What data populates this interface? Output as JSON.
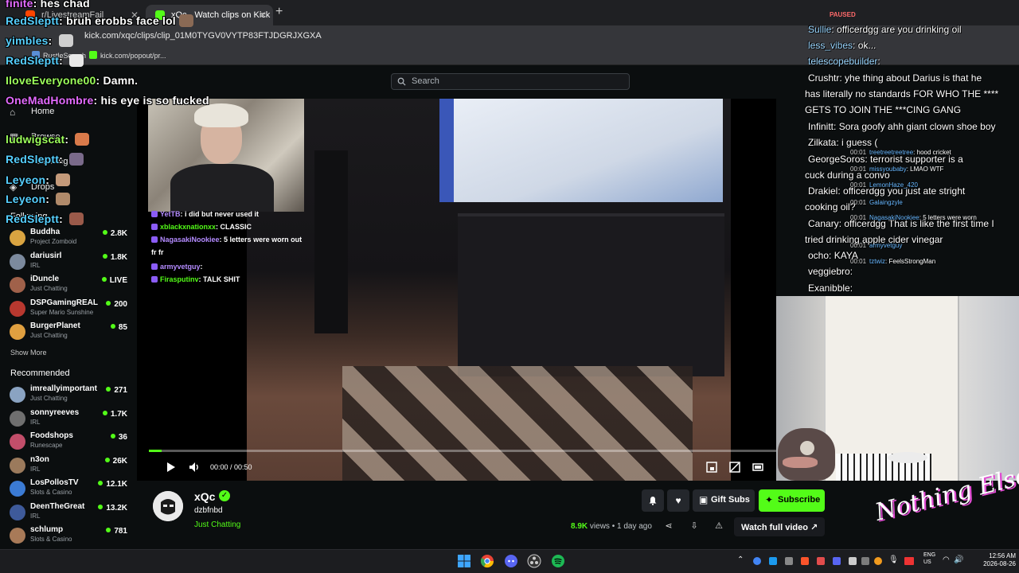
{
  "browser": {
    "tabs": [
      {
        "label": "r/LivestreamFail",
        "active": false
      },
      {
        "label": "xQc - Watch clips on Kick",
        "active": true
      }
    ],
    "url": "kick.com/xqc/clips/clip_01M0TYGV0VYTP83FTJDGRJXGXA",
    "bookmarks": [
      "RustleSearch",
      "kick.com/popout/pr..."
    ]
  },
  "header": {
    "search_placeholder": "Search"
  },
  "sidebar": {
    "nav": [
      "Home",
      "Browse",
      "Following",
      "Drops"
    ],
    "following_heading": "Following",
    "following": [
      {
        "name": "Buddha",
        "category": "Project Zomboid",
        "viewers": "2.8K",
        "color": "#d9a441"
      },
      {
        "name": "dariusirl",
        "category": "IRL",
        "viewers": "1.8K",
        "color": "#7c8a9e"
      },
      {
        "name": "iDuncle",
        "category": "Just Chatting",
        "viewers": "LIVE",
        "color": "#a0614a"
      },
      {
        "name": "DSPGamingREAL",
        "category": "Super Mario Sunshine",
        "viewers": "200",
        "color": "#b8382f"
      },
      {
        "name": "BurgerPlanet",
        "category": "Just Chatting",
        "viewers": "85",
        "color": "#e0a040"
      }
    ],
    "show_more": "Show More",
    "recommended_heading": "Recommended",
    "recommended": [
      {
        "name": "imreallyimportant",
        "category": "Just Chatting",
        "viewers": "271",
        "color": "#8aa3c2"
      },
      {
        "name": "sonnyreeves",
        "category": "IRL",
        "viewers": "1.7K",
        "color": "#6f6f6f"
      },
      {
        "name": "Foodshops",
        "category": "Runescape",
        "viewers": "36",
        "color": "#c24e6a"
      },
      {
        "name": "n3on",
        "category": "IRL",
        "viewers": "26K",
        "color": "#9b7a5c"
      },
      {
        "name": "LosPollosTV",
        "category": "Slots & Casino",
        "viewers": "12.1K",
        "color": "#3b7bd4"
      },
      {
        "name": "DeenTheGreat",
        "category": "IRL",
        "viewers": "13.2K",
        "color": "#3e5a9a"
      },
      {
        "name": "schlump",
        "category": "Slots & Casino",
        "viewers": "781",
        "color": "#a87a58"
      }
    ]
  },
  "overlay_chat_left": [
    {
      "user": "finite",
      "msg": "hes chad"
    },
    {
      "user": "RedSleptt",
      "msg": "bruh erobbs face lol"
    },
    {
      "user": "yimbles",
      "msg": ""
    },
    {
      "user": "RedSleptt",
      "msg": ""
    },
    {
      "user": "IloveEveryone00",
      "msg": "Damn."
    },
    {
      "user": "OneMadHombre",
      "msg": "his eye is so fucked"
    },
    {
      "user": "ludwigscat",
      "msg": ""
    },
    {
      "user": "RedSleptt",
      "msg": ""
    },
    {
      "user": "Leyeon",
      "msg": ""
    },
    {
      "user": "Leyeon",
      "msg": ""
    },
    {
      "user": "RedSleptt",
      "msg": ""
    }
  ],
  "video_chat": [
    {
      "user": "YetTB",
      "msg": "i did but never used it"
    },
    {
      "user": "xblackxnationxx",
      "msg": "CLASSIC"
    },
    {
      "user": "NagasakiNookiee",
      "msg": "5 letters were worn out"
    },
    {
      "user": "",
      "msg": "fr fr"
    },
    {
      "user": "armyvetguy",
      "msg": ""
    },
    {
      "user": "Firasputinv",
      "msg": "TALK SHIT"
    }
  ],
  "player": {
    "time": "00:00 / 00:50",
    "progress": 0.02
  },
  "right_chat": [
    {
      "user": "Sullie",
      "msg": "officerdgg are you drinking oil"
    },
    {
      "user": "less_vibes",
      "msg": "ok..."
    },
    {
      "user": "telescopebuilder",
      "msg": ""
    },
    {
      "user": "Crushtr",
      "msg": "yhe thing about Darius is that he"
    },
    {
      "user": "",
      "msg": "has literally no standards FOR WHO THE ****"
    },
    {
      "user": "",
      "msg": "GETS TO JOIN THE ***CING GANG"
    },
    {
      "user": "Infinitt",
      "msg": "Sora goofy ahh giant clown shoe boy"
    },
    {
      "user": "Zilkata",
      "msg": "i guess ("
    },
    {
      "user": "GeorgeSoros",
      "msg": "terrorist supporter is a"
    },
    {
      "user": "",
      "msg": "cuck during a convo"
    },
    {
      "user": "Drakiel",
      "msg": "officerdgg you just ate stright"
    },
    {
      "user": "",
      "msg": "cooking oil?"
    },
    {
      "user": "Canary",
      "msg": "officerdgg That is like the first time I"
    },
    {
      "user": "",
      "msg": "tried drinking apple cider vinegar"
    },
    {
      "user": "ocho",
      "msg": "KAYA"
    },
    {
      "user": "veggiebro",
      "msg": ""
    },
    {
      "user": "Exanibble",
      "msg": ""
    }
  ],
  "right_tiny_chat": [
    {
      "t": "00:01",
      "user": "treetreetreetree",
      "msg": "hood cricket"
    },
    {
      "t": "00:01",
      "user": "missyoubaby",
      "msg": "LMAO WTF"
    },
    {
      "t": "00:01",
      "user": "LemonHaze_420",
      "msg": ""
    },
    {
      "t": "00:01",
      "user": "Galaingzyle",
      "msg": ""
    },
    {
      "t": "00:01",
      "user": "NagasakiNookiee",
      "msg": "5 letters were worn"
    },
    {
      "t": "00:01",
      "user": "armyvetguy",
      "msg": ""
    },
    {
      "t": "00:01",
      "user": "tztwiz",
      "msg": "FeelsStrongMan"
    }
  ],
  "paused_label": "PAUSED",
  "channel": {
    "name": "xQc",
    "clip_title": "dzbfnbd",
    "category": "Just Chatting",
    "views": "8.9K",
    "views_label": "views",
    "age": "1 day ago",
    "gift_label": "Gift Subs",
    "subscribe_label": "Subscribe",
    "watch_full_label": "Watch full video"
  },
  "brand_text": "Nothing Else?",
  "taskbar": {
    "lang": "ENG",
    "region": "US",
    "time": "12:56 AM",
    "date": "2026-08-26"
  },
  "colors": {
    "kick_green": "#53fc18",
    "bg": "#0b0e0f"
  }
}
